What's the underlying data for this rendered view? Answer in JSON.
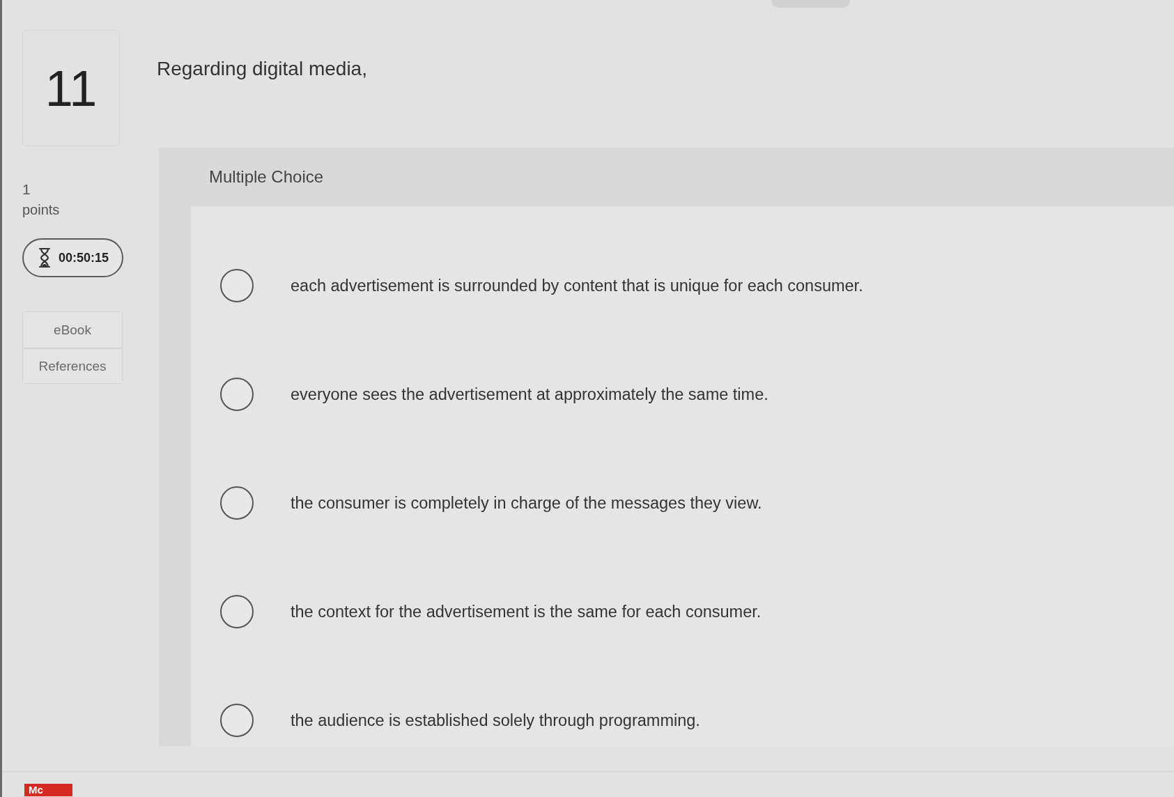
{
  "question": {
    "number": "11",
    "prompt": "Regarding digital media,"
  },
  "score": {
    "value": "1",
    "unit": "points"
  },
  "timer": {
    "time": "00:50:15"
  },
  "tools": [
    "eBook",
    "References"
  ],
  "answer_panel": {
    "type_label": "Multiple Choice",
    "options": [
      {
        "text": "each advertisement is surrounded by content that is unique for each consumer.",
        "selected": false
      },
      {
        "text": "everyone sees the advertisement at approximately the same time.",
        "selected": false
      },
      {
        "text": "the consumer is completely in charge of the messages they view.",
        "selected": false
      },
      {
        "text": "the context for the advertisement is the same for each consumer.",
        "selected": false
      },
      {
        "text": "the audience is established solely through programming.",
        "selected": false
      }
    ]
  },
  "footer": {
    "logo": "Mc"
  }
}
